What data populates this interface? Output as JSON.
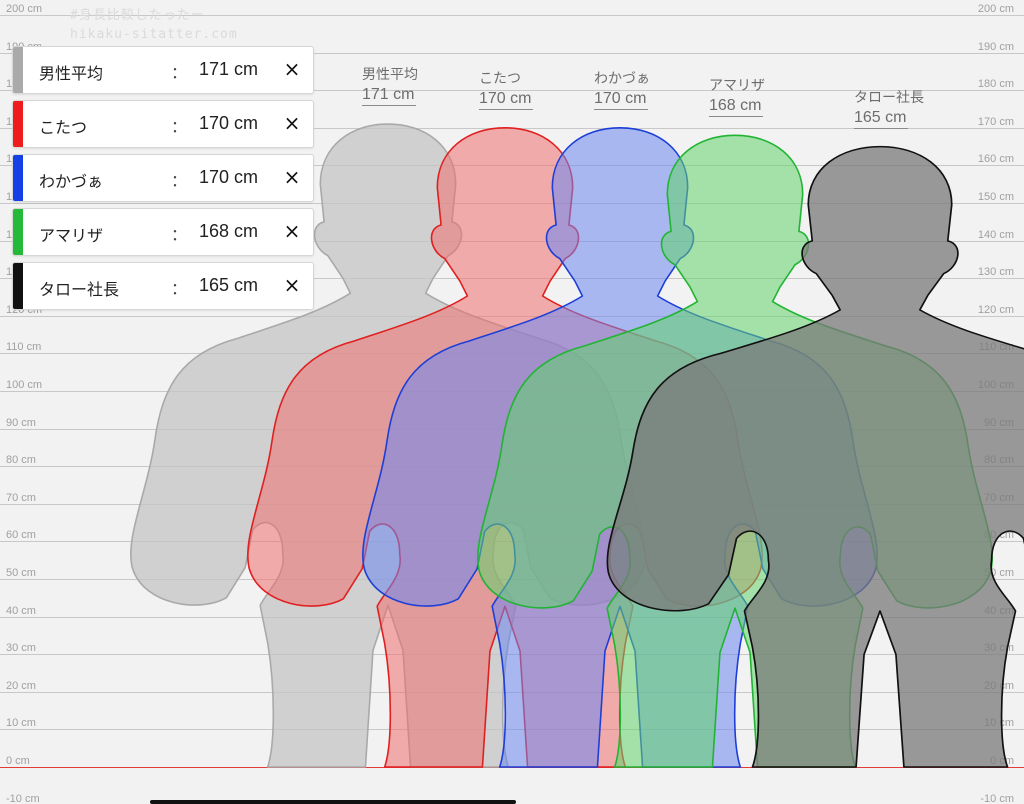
{
  "watermark": {
    "line1": "#身長比較したったー",
    "line2": "hikaku-sitatter.com"
  },
  "axis": {
    "unit": "cm",
    "min": -10,
    "max": 200,
    "step": 10,
    "labels": [
      "200 cm",
      "190 cm",
      "180 cm",
      "170 cm",
      "160 cm",
      "150 cm",
      "140 cm",
      "130 cm",
      "120 cm",
      "110 cm",
      "100 cm",
      "90 cm",
      "80 cm",
      "70 cm",
      "60 cm",
      "50 cm",
      "40 cm",
      "30 cm",
      "20 cm",
      "10 cm",
      "0 cm",
      "-10 cm"
    ]
  },
  "people": [
    {
      "name": "男性平均",
      "height_label": "171 cm",
      "height": 171,
      "color": "#aaaaaa",
      "fill": "#c4c4c4",
      "stroke": "#a9a9a9",
      "opacity": 0.75
    },
    {
      "name": "こたつ",
      "height_label": "170 cm",
      "height": 170,
      "color": "#ee1c1c",
      "fill": "#ef6f6f",
      "stroke": "#e02020",
      "opacity": 0.55
    },
    {
      "name": "わかづぁ",
      "height_label": "170 cm",
      "height": 170,
      "color": "#1440e6",
      "fill": "#6e86ef",
      "stroke": "#1d3fd8",
      "opacity": 0.55
    },
    {
      "name": "アマリザ",
      "height_label": "168 cm",
      "height": 168,
      "color": "#25b93a",
      "fill": "#63d46d",
      "stroke": "#21b433",
      "opacity": 0.55
    },
    {
      "name": "タロー社長",
      "height_label": "165 cm",
      "height": 165,
      "color": "#111111",
      "fill": "#7a7a7a",
      "stroke": "#111111",
      "opacity": 0.75
    }
  ],
  "list": {
    "separator": "：",
    "close_glyph": "×"
  }
}
